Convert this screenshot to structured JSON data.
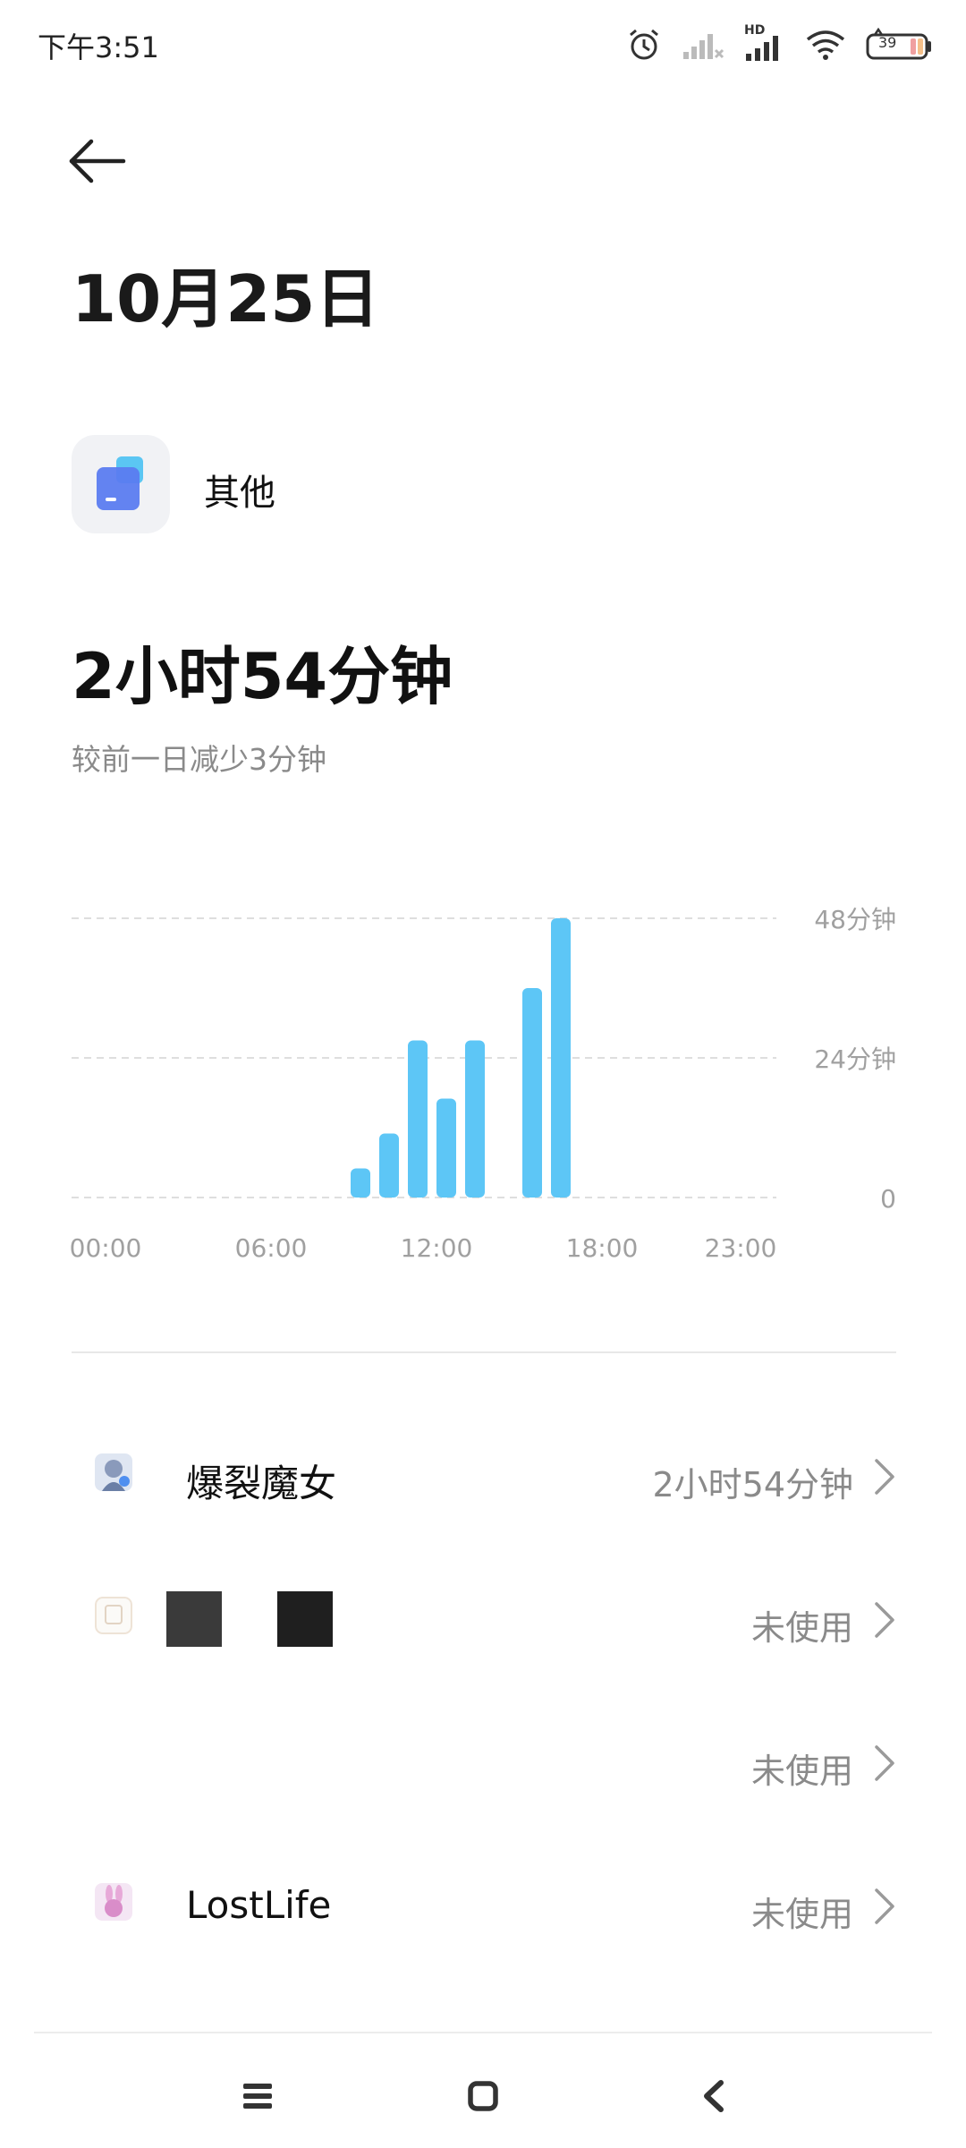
{
  "status_bar": {
    "time": "下午3:51",
    "network_label": "HD",
    "battery_level": "39",
    "icons": [
      "alarm-icon",
      "signal-x-icon",
      "signal-hd-icon",
      "wifi-icon",
      "battery-icon"
    ]
  },
  "header": {
    "back_icon": "arrow-left-icon",
    "title": "10月25日"
  },
  "category": {
    "icon": "app-category-icon",
    "label": "其他"
  },
  "summary": {
    "total_time": "2小时54分钟",
    "comparison": "较前一日减少3分钟"
  },
  "chart_data": {
    "type": "bar",
    "x_tick_labels": [
      "00:00",
      "06:00",
      "12:00",
      "18:00",
      "23:00"
    ],
    "y_tick_labels": [
      "48分钟",
      "24分钟",
      "0"
    ],
    "ylim": [
      0,
      48
    ],
    "grid": true,
    "bar_color": "#5dc6f6",
    "hours": [
      9,
      10,
      11,
      12,
      13,
      15,
      16
    ],
    "values": [
      5,
      11,
      27,
      17,
      27,
      36,
      48
    ]
  },
  "apps": [
    {
      "name": "爆裂魔女",
      "usage": "2小时54分钟",
      "icon": "game-app-icon"
    },
    {
      "name": "",
      "usage": "未使用",
      "icon": "app-icon"
    },
    {
      "name": "",
      "usage": "未使用",
      "icon": ""
    },
    {
      "name": "LostLife",
      "usage": "未使用",
      "icon": "bunny-app-icon"
    }
  ],
  "nav": {
    "menu_icon": "menu-icon",
    "home_icon": "home-icon",
    "back_icon": "back-icon"
  }
}
